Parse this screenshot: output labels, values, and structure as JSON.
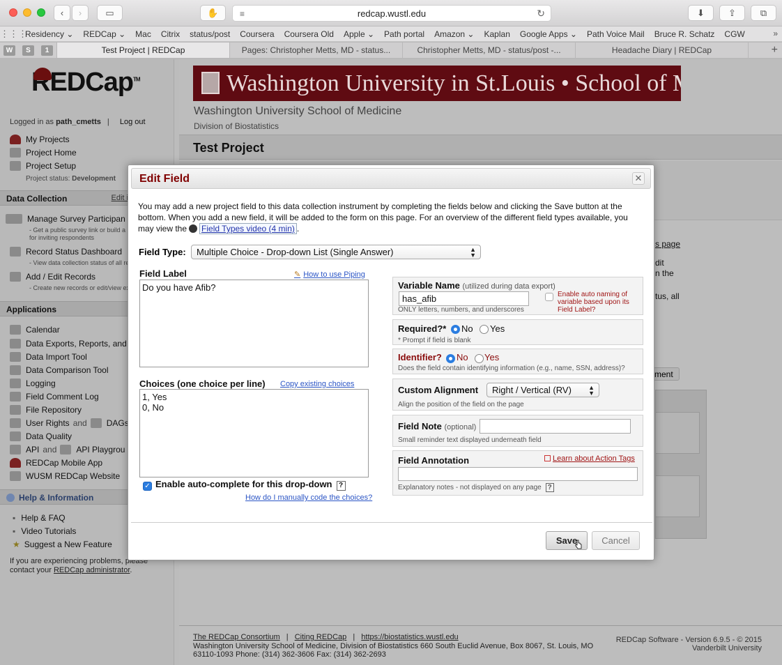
{
  "browser": {
    "url": "redcap.wustl.edu",
    "bookmarks": [
      "Residency ⌄",
      "REDCap ⌄",
      "Mac",
      "Citrix",
      "status/post",
      "Coursera",
      "Coursera Old",
      "Apple ⌄",
      "Path portal",
      "Amazon ⌄",
      "Kaplan",
      "Google Apps ⌄",
      "Path Voice Mail",
      "Bruce R. Schatz",
      "CGW"
    ],
    "pinned_tabs": [
      "W",
      "S",
      "1"
    ],
    "tabs": [
      "Test Project | REDCap",
      "Pages: Christopher Metts, MD - status...",
      "Christopher Metts, MD - status/post -...",
      "Headache Diary | REDCap"
    ]
  },
  "sidebar": {
    "logo": "REDCap",
    "logged_in_prefix": "Logged in as",
    "username": "path_cmetts",
    "logout": "Log out",
    "my_projects": "My Projects",
    "project_home": "Project Home",
    "project_setup": "Project Setup",
    "project_status_label": "Project status:",
    "project_status": "Development",
    "data_collection_header": "Data Collection",
    "edit_instr": "Edit i",
    "manage_survey": "Manage Survey Participan",
    "manage_survey_sub1": "- Get a public survey link or build a p",
    "manage_survey_sub2": "for inviting respondents",
    "record_status": "Record Status Dashboard",
    "record_status_sub": "- View data collection status of all re",
    "add_edit": "Add / Edit Records",
    "add_edit_sub": "- Create new records or edit/view ex",
    "applications_header": "Applications",
    "apps": [
      "Calendar",
      "Data Exports, Reports, and",
      "Data Import Tool",
      "Data Comparison Tool",
      "Logging",
      "Field Comment Log",
      "File Repository",
      "User Rights",
      "Data Quality",
      "API",
      "REDCap Mobile App",
      "WUSM REDCap Website"
    ],
    "and_text": "and",
    "dags": "DAGs",
    "api_playground": "API Playgrou",
    "help_header": "Help & Information",
    "help_items": [
      "Help & FAQ",
      "Video Tutorials",
      "Suggest a New Feature"
    ],
    "problems_text_1": "If you are experiencing problems, please",
    "problems_text_2": "contact your",
    "problems_link": "REDCap administrator",
    "problems_end": "."
  },
  "main": {
    "banner": "Washington University in St.Louis • School of Medicine",
    "sub1": "Washington University School of Medicine",
    "sub2": "Division of Biostatistics",
    "project_title": "Test Project",
    "bg_frag_page": "s page",
    "bg_frag_dit": "dit",
    "bg_frag_nthe": "n the",
    "bg_frag_tus": "tus, all",
    "bg_frag_ment": "ment",
    "footer_link1": "The REDCap Consortium",
    "footer_link2": "Citing REDCap",
    "footer_link3": "https://biostatistics.wustl.edu",
    "footer_sep": "|",
    "footer_addr": "Washington University School of Medicine, Division of Biostatistics 660 South Euclid Avenue, Box 8067, St. Louis, MO 63110-1093 Phone: (314) 362-3606 Fax: (314) 362-2693",
    "footer_ver1": "REDCap Software - Version 6.9.5 - © 2015",
    "footer_ver2": "Vanderbilt University"
  },
  "dialog": {
    "title": "Edit Field",
    "close": "✕",
    "intro": "You may add a new project field to this data collection instrument by completing the fields below and clicking the Save button at the bottom. When you add a new field, it will be added to the form on this page. For an overview of the different field types available, you may view the",
    "video_link": "Field Types video (4 min)",
    "intro_end": ".",
    "field_type_label": "Field Type:",
    "field_type_value": "Multiple Choice - Drop-down List (Single Answer)",
    "field_label_title": "Field Label",
    "piping_link": "How to use Piping",
    "field_label_value": "Do you have Afib?",
    "choices_title": "Choices (one choice per line)",
    "copy_choices": "Copy existing choices",
    "choices_value": "1, Yes\n0, No",
    "autocomplete_label": "Enable auto-complete for this drop-down",
    "help_q": "?",
    "manual_code_link": "How do I manually code the choices?",
    "variable_name_title": "Variable Name",
    "variable_name_hint": "(utilized during data export)",
    "variable_name_value": "has_afib",
    "variable_name_note": "ONLY letters, numbers, and underscores",
    "auto_naming": "Enable auto naming of variable based upon its Field Label?",
    "required_title": "Required?*",
    "required_note": "* Prompt if field is blank",
    "identifier_title": "Identifier?",
    "identifier_note": "Does the field contain identifying information (e.g., name, SSN, address)?",
    "no": "No",
    "yes": "Yes",
    "alignment_title": "Custom Alignment",
    "alignment_value": "Right / Vertical (RV)",
    "alignment_note": "Align the position of the field on the page",
    "field_note_title": "Field Note",
    "field_note_optional": "(optional)",
    "field_note_value": "",
    "field_note_note": "Small reminder text displayed underneath field",
    "annotation_title": "Field Annotation",
    "action_tags_link": "Learn about Action Tags",
    "annotation_value": "",
    "annotation_note": "Explanatory notes - not displayed on any page",
    "save": "Save",
    "cancel": "Cancel"
  },
  "colors": {
    "dialog_title": "#800000",
    "accent": "#2b7de0",
    "banner": "#5f0b12"
  }
}
